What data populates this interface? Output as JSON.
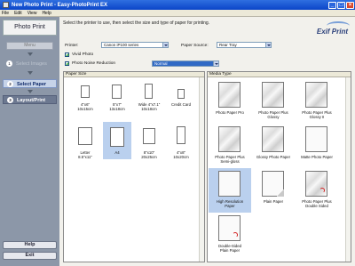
{
  "window": {
    "title": "New Photo Print - Easy-PhotoPrint EX"
  },
  "menu": [
    "File",
    "Edit",
    "View",
    "Help"
  ],
  "sidebar": {
    "header": "Photo Print",
    "menu_button": "Menu",
    "steps": [
      {
        "num": "1",
        "label": "Select Images"
      },
      {
        "num": "2",
        "label": "Select Paper"
      },
      {
        "num": "3",
        "label": "Layout/Print"
      }
    ],
    "help": "Help",
    "exit": "Exit"
  },
  "main": {
    "instruction": "Select the printer to use, then select the size and type of paper for printing.",
    "brand": "Exif Print",
    "printer_label": "Printer:",
    "printer_value": "Canon iP100 series",
    "source_label": "Paper Source:",
    "source_value": "Rear Tray",
    "vivid_label": "Vivid Photo",
    "noise_label": "Photo Noise Reduction",
    "noise_value": "Normal"
  },
  "paper_size": {
    "header": "Paper Size",
    "items": [
      {
        "l1": "4\"x6\"",
        "l2": "10x15cm"
      },
      {
        "l1": "5\"x7\"",
        "l2": "13x18cm"
      },
      {
        "l1": "Wide 4\"x7.1\"",
        "l2": "10x18cm"
      },
      {
        "l1": "Credit Card",
        "l2": ""
      },
      {
        "l1": "Letter",
        "l2": "8.5\"x11\""
      },
      {
        "l1": "A4",
        "l2": ""
      },
      {
        "l1": "8\"x10\"",
        "l2": "20x25cm"
      },
      {
        "l1": "4\"x8\"",
        "l2": "10x20cm"
      }
    ]
  },
  "media_type": {
    "header": "Media Type",
    "items": [
      {
        "l1": "Photo Paper Pro",
        "l2": ""
      },
      {
        "l1": "Photo Paper Plus",
        "l2": "Glossy"
      },
      {
        "l1": "Photo Paper Plus",
        "l2": "Glossy II"
      },
      {
        "l1": "Photo Paper Plus",
        "l2": "Semi-gloss"
      },
      {
        "l1": "Glossy Photo Paper",
        "l2": ""
      },
      {
        "l1": "Matte Photo Paper",
        "l2": ""
      },
      {
        "l1": "High Resolution",
        "l2": "Paper"
      },
      {
        "l1": "Plain Paper",
        "l2": ""
      },
      {
        "l1": "Photo Paper Plus",
        "l2": "Double Sided"
      },
      {
        "l1": "Double-Sided",
        "l2": "Plain Paper"
      }
    ]
  }
}
